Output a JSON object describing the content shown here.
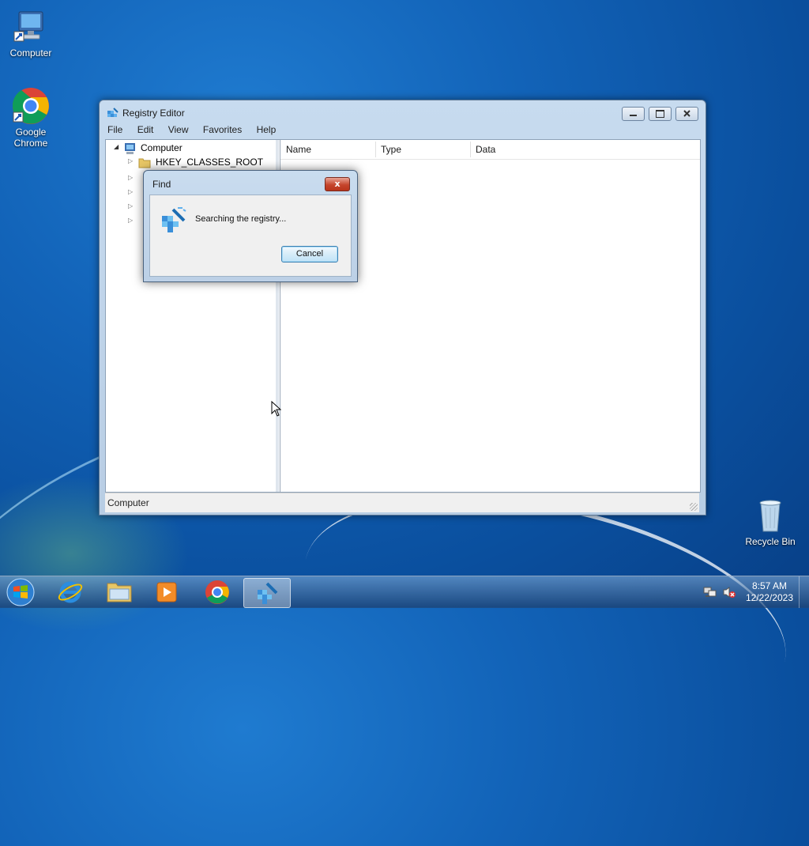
{
  "desktop": {
    "icons": [
      {
        "label": "Computer"
      },
      {
        "label": "Google Chrome"
      },
      {
        "label": "Recycle Bin"
      }
    ]
  },
  "window": {
    "title": "Registry Editor",
    "menu": [
      "File",
      "Edit",
      "View",
      "Favorites",
      "Help"
    ],
    "tree": {
      "root": "Computer",
      "items": [
        "HKEY_CLASSES_ROOT"
      ]
    },
    "columns": [
      "Name",
      "Type",
      "Data"
    ],
    "status": "Computer"
  },
  "dialog": {
    "title": "Find",
    "message": "Searching the registry...",
    "cancel_label": "Cancel",
    "close_glyph": "x"
  },
  "taskbar": {
    "time": "8:57 AM",
    "date": "12/22/2023"
  },
  "colors": {
    "desktop": "#1263b8",
    "close_button": "#c5452c"
  }
}
